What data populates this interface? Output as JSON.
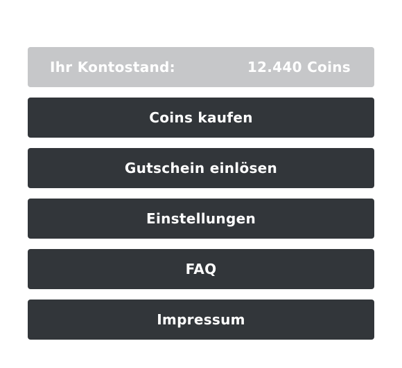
{
  "account": {
    "balance_label": "Ihr Kontostand:",
    "balance_value": "12.440 Coins"
  },
  "menu": {
    "items": [
      {
        "label": "Coins kaufen"
      },
      {
        "label": "Gutschein einlösen"
      },
      {
        "label": "Einstellungen"
      },
      {
        "label": "FAQ"
      },
      {
        "label": "Impressum"
      }
    ]
  },
  "colors": {
    "balance_bg": "#c6c7c9",
    "button_bg": "#32363a",
    "text": "#ffffff"
  }
}
